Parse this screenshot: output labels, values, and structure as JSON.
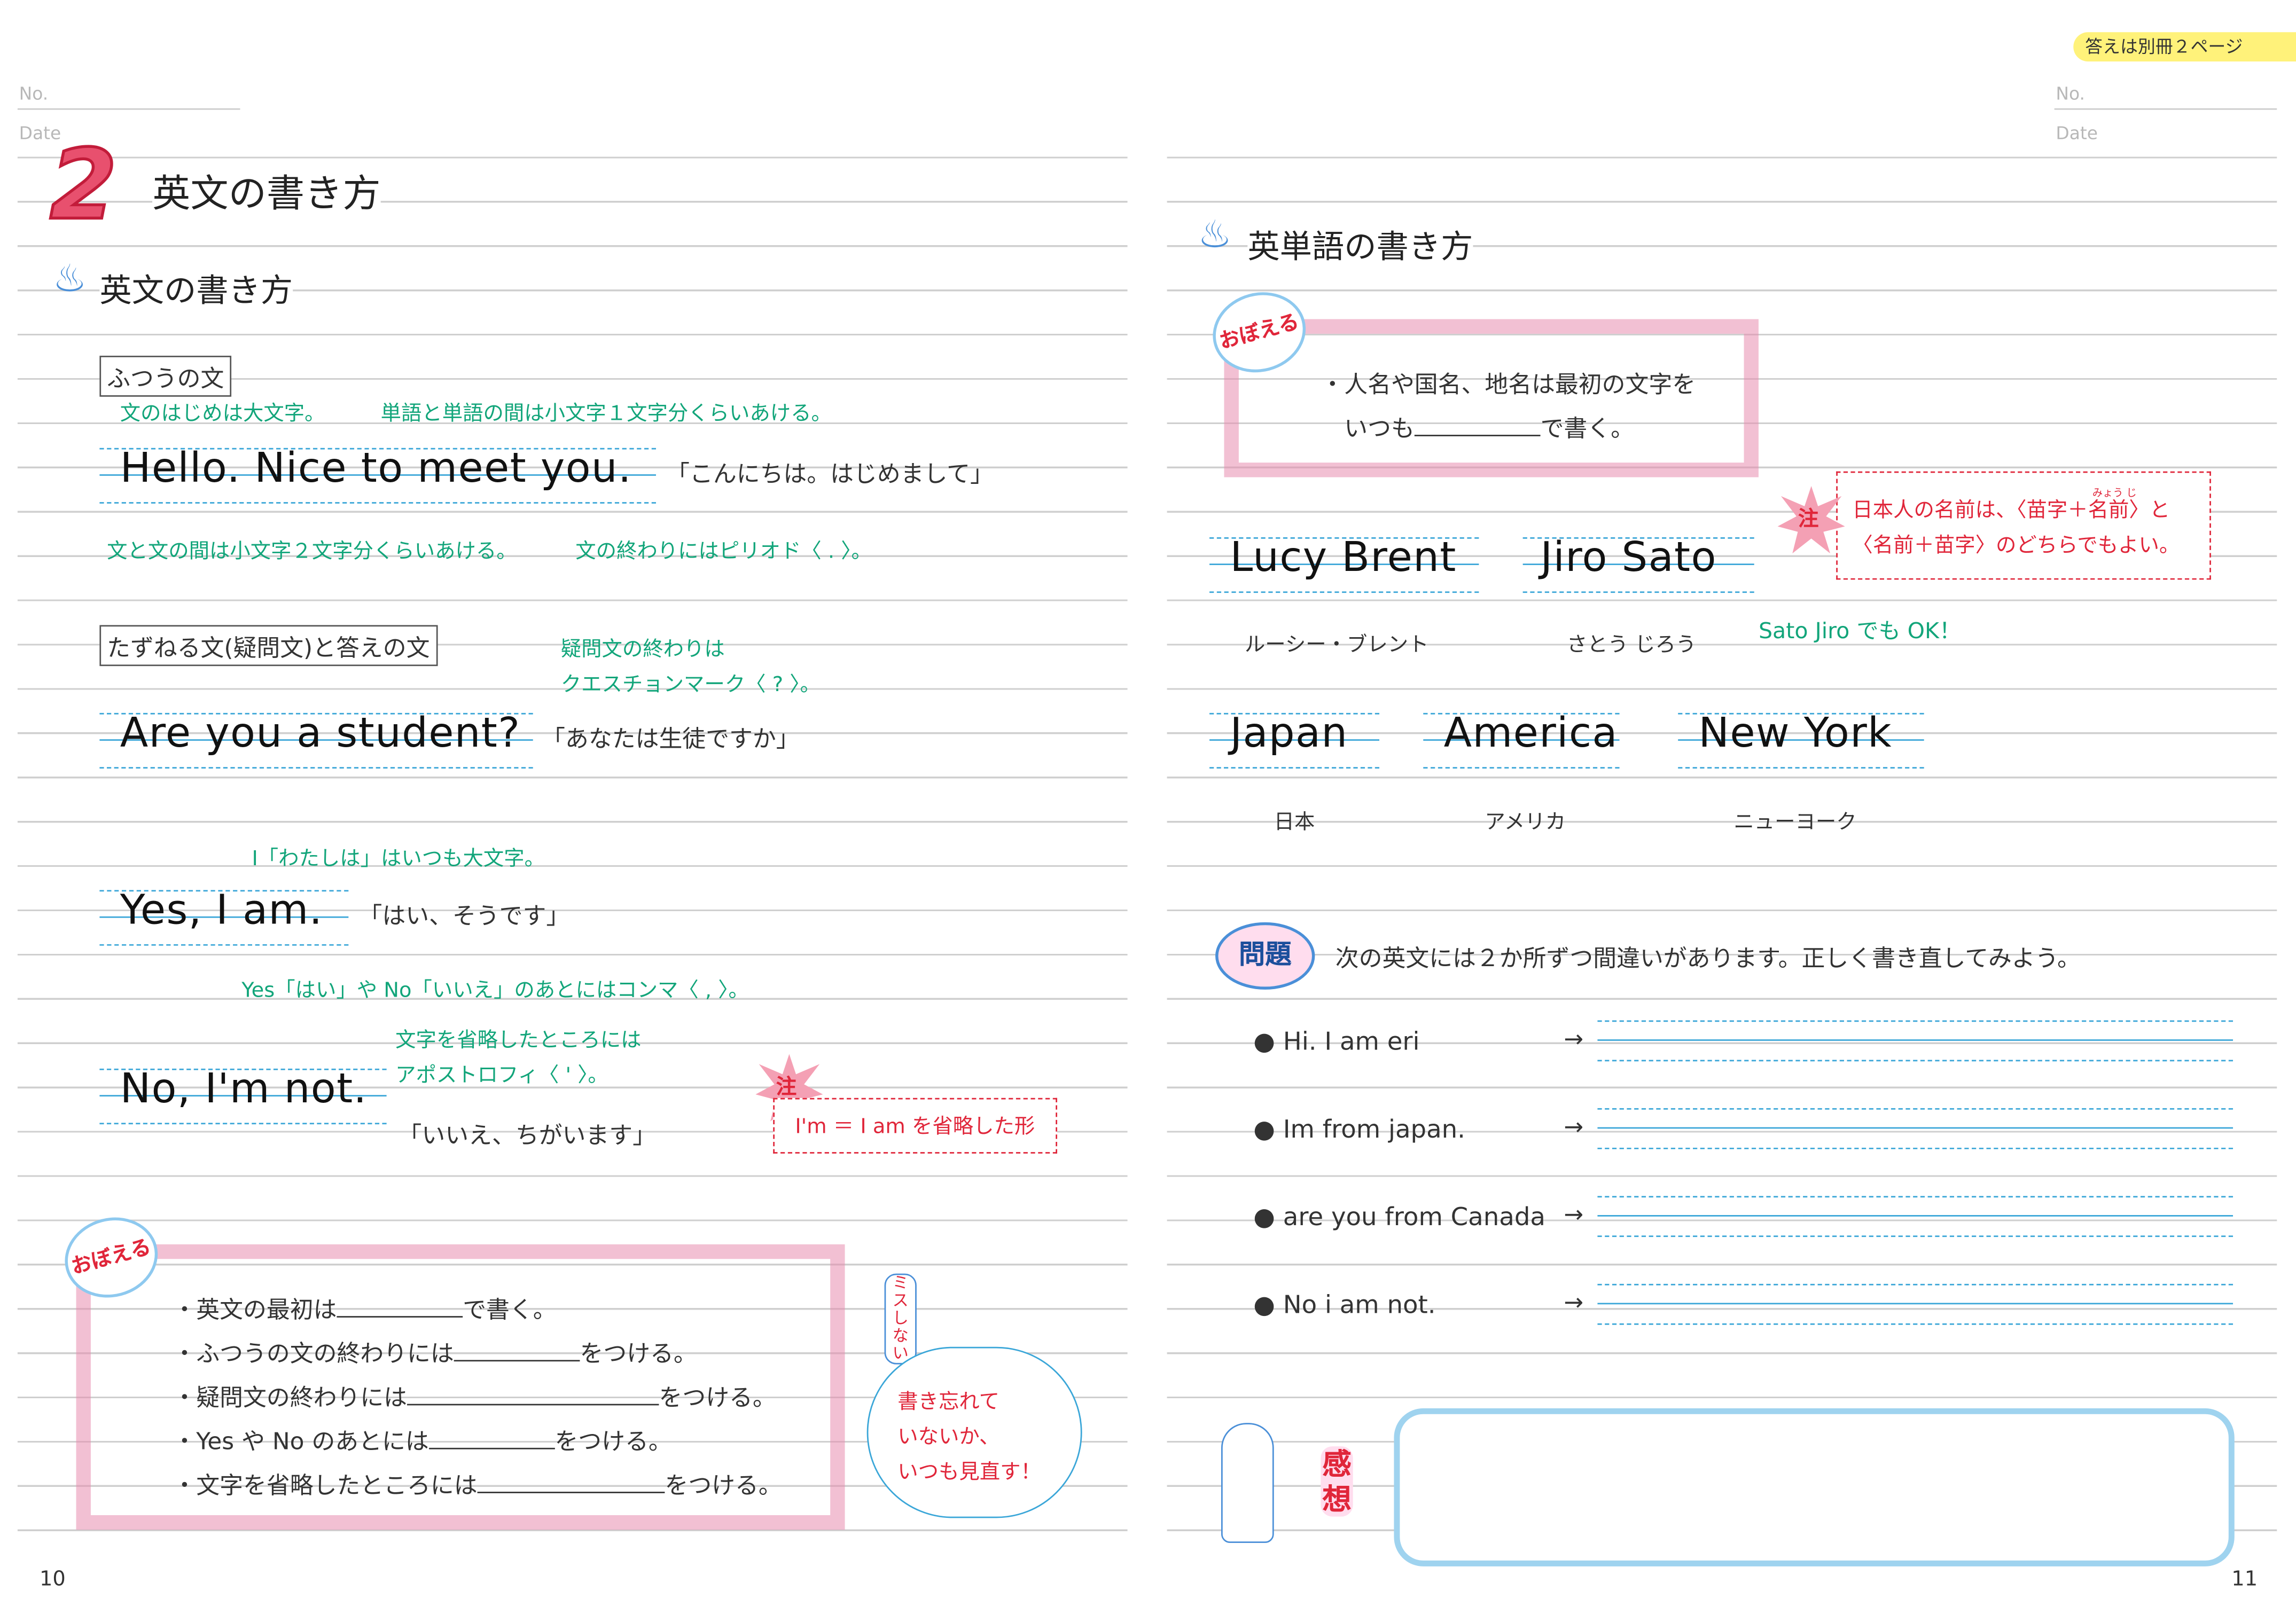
{
  "answer_tab": "答えは別冊２ページ",
  "meta": {
    "no": "No.",
    "date": "Date"
  },
  "left": {
    "chapter_number": "2",
    "chapter_title": "英文の書き方",
    "section_title": "英文の書き方",
    "plain": {
      "label": "ふつうの文",
      "note_capital": "文のはじめは大文字。",
      "note_word_space": "単語と単語の間は小文字１文字分くらいあける。",
      "sentence": "Hello.  Nice to meet you.",
      "translation": "「こんにちは。はじめまして」",
      "note_sentence_space": "文と文の間は小文字２文字分くらいあける。",
      "note_period": "文の終わりにはピリオド〈 . 〉。"
    },
    "question": {
      "label": "たずねる文(疑問文)と答えの文",
      "note_qmark_1": "疑問文の終わりは",
      "note_qmark_2": "クエスチョンマーク〈 ? 〉。",
      "sentence": "Are you a student?",
      "translation": "「あなたは生徒ですか」",
      "note_i": "I「わたしは」はいつも大文字。",
      "answer1": "Yes, I am.",
      "answer1_translation": "「はい、そうです」",
      "note_comma": "Yes「はい」や No「いいえ」のあとにはコンマ〈 , 〉。",
      "note_apos_1": "文字を省略したところには",
      "note_apos_2": "アポストロフィ〈 ' 〉。",
      "answer2": "No, I'm not.",
      "answer2_translation": "「いいえ、ちがいます」",
      "chu_badge": "注",
      "chu_note": "I'm ＝ I am を省略した形"
    },
    "oboeru": {
      "badge": "おぼえる",
      "items": [
        {
          "pre": "・英文の最初は",
          "post": "で書く。"
        },
        {
          "pre": "・ふつうの文の終わりには",
          "post": "をつける。"
        },
        {
          "pre": "・疑問文の終わりには",
          "post": "をつける。"
        },
        {
          "pre": "・Yes や No のあとには",
          "post": "をつける。"
        },
        {
          "pre": "・文字を省略したところには",
          "post": "をつける。"
        }
      ]
    },
    "miss_badge": "ミスしない",
    "cloud_note": [
      "書き忘れて",
      "いないか、",
      "いつも見直す！"
    ],
    "page_number": "10"
  },
  "right": {
    "section_title": "英単語の書き方",
    "oboeru": {
      "badge": "おぼえる",
      "line1": "・人名や国名、地名は最初の文字を",
      "line2_pre": "いつも",
      "line2_post": "で書く。"
    },
    "chu_badge": "注",
    "chu_note_1": "日本人の名前は、〈苗字＋名前〉と",
    "chu_ruby": "みょう じ",
    "chu_note_2": "〈名前＋苗字〉のどちらでもよい。",
    "names": [
      {
        "word": "Lucy Brent",
        "reading": "ルーシー・ブレント"
      },
      {
        "word": "Jiro Sato",
        "reading": "さとう じろう"
      }
    ],
    "sato_note": "Sato Jiro でも OK！",
    "places": [
      {
        "word": "Japan",
        "reading": "日本"
      },
      {
        "word": "America",
        "reading": "アメリカ"
      },
      {
        "word": "New York",
        "reading": "ニューヨーク"
      }
    ],
    "problem": {
      "badge": "問題",
      "instruction": "次の英文には２か所ずつ間違いがあります。正しく書き直してみよう。",
      "items": [
        "Hi.  I am eri",
        "Im from japan.",
        "are you from Canada",
        "No i am not."
      ],
      "arrow": "→"
    },
    "kansou_badge": "感想",
    "page_number": "11"
  },
  "colors": {
    "accent_green": "#12a57a",
    "accent_red": "#e0263a",
    "guide_blue": "#3aa6d8",
    "highlight_pink": "#e88caf",
    "tab_yellow": "#fff27a"
  }
}
